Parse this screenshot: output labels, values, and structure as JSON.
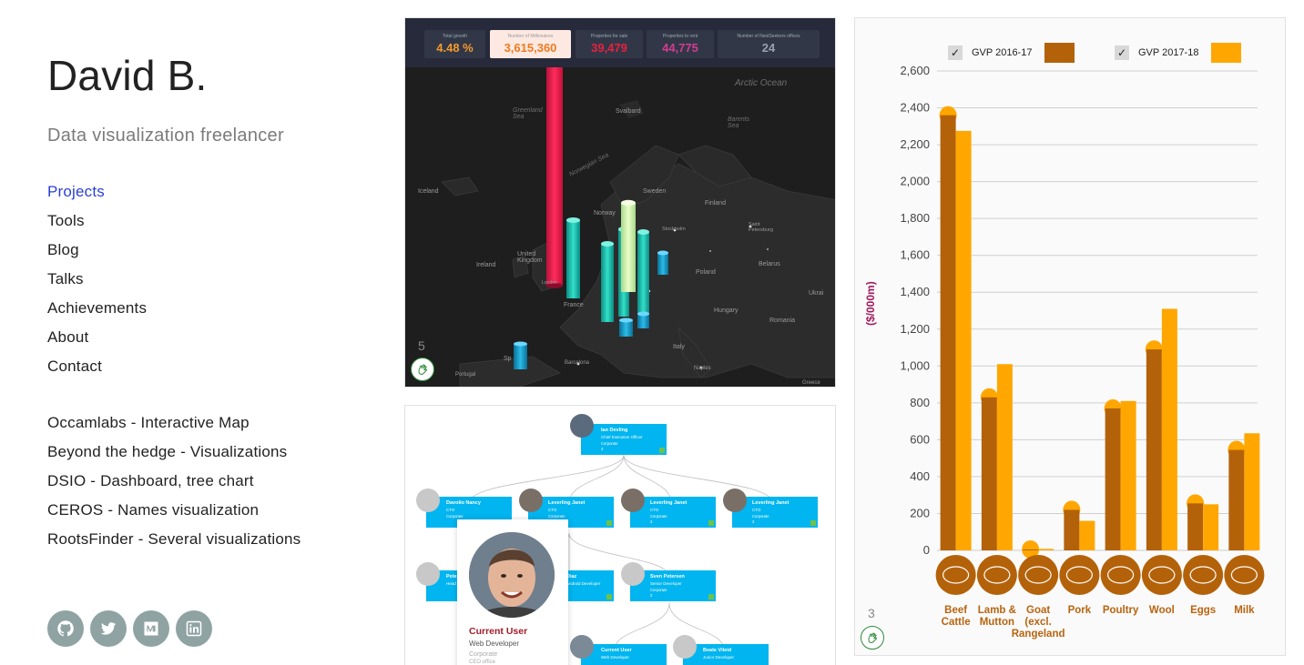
{
  "site": {
    "title": "David B.",
    "subtitle": "Data visualization freelancer"
  },
  "nav": [
    {
      "label": "Projects",
      "active": true
    },
    {
      "label": "Tools"
    },
    {
      "label": "Blog"
    },
    {
      "label": "Talks"
    },
    {
      "label": "Achievements"
    },
    {
      "label": "About"
    },
    {
      "label": "Contact"
    }
  ],
  "projects": [
    {
      "label": "Occamlabs - Interactive Map"
    },
    {
      "label": "Beyond the hedge - Visualizations"
    },
    {
      "label": "DSIO - Dashboard, tree chart"
    },
    {
      "label": "CEROS - Names visualization"
    },
    {
      "label": "RootsFinder - Several visualizations"
    }
  ],
  "socials": [
    {
      "name": "github-icon"
    },
    {
      "name": "twitter-icon"
    },
    {
      "name": "medium-icon"
    },
    {
      "name": "linkedin-icon"
    }
  ],
  "map_card": {
    "number": "5",
    "kpis": [
      {
        "label": "Total growth",
        "value": "4.48 %",
        "color": "#f39a2b"
      },
      {
        "label": "Number of Millionaires",
        "value": "3,615,360",
        "color": "#f07a1f"
      },
      {
        "label": "Properties for sale",
        "value": "39,479",
        "color": "#e8213f"
      },
      {
        "label": "Properties to rent",
        "value": "44,775",
        "color": "#d13d8f"
      },
      {
        "label": "Number of NestSeekers offices",
        "value": "24",
        "color": "#9a9fae"
      }
    ],
    "labels": {
      "arctic": "Arctic Ocean",
      "greenland_sea": "Greenland Sea",
      "barents_sea": "Barents Sea",
      "norwegian_sea": "Norwegian Sea",
      "svalbard": "Svalbard",
      "iceland": "Iceland",
      "sweden": "Sweden",
      "finland": "Finland",
      "norway": "Norway",
      "stockholm": "Stockholm",
      "st_petersburg": "Saint Petersburg",
      "uk": "United Kingdom",
      "ireland": "Ireland",
      "poland": "Poland",
      "belarus": "Belarus",
      "ukraine": "Ukrai",
      "france": "France",
      "hungary": "Hungary",
      "romania": "Romania",
      "italy": "Italy",
      "spain": "Sp",
      "barcelona": "Barcelona",
      "naples": "Naples",
      "portugal": "Portugal",
      "london": "London",
      "greece": "Greece"
    }
  },
  "org_card": {
    "root": {
      "name": "Ian Devling",
      "role": "Chief Executive Officer",
      "group": "Corporate",
      "count": "4"
    },
    "level1": [
      {
        "name": "Davolio Nancy",
        "role": "CTO",
        "group": "Corporate",
        "count": "3"
      },
      {
        "name": "Leverling Janet",
        "role": "CTO",
        "group": "Corporate",
        "count": "3"
      },
      {
        "name": "Leverling Janet",
        "role": "CTO",
        "group": "Corporate",
        "count": "3"
      },
      {
        "name": "Leverling Janet",
        "role": "CTO",
        "group": "Corporate",
        "count": "3"
      }
    ],
    "level2": [
      {
        "name": "Pete",
        "role": "Head",
        "group": "Corp",
        "count": "3"
      },
      {
        "name": "Diaz",
        "role": "Android Developer",
        "group": "",
        "count": ""
      },
      {
        "name": "Sven Petersen",
        "role": "Senior Developer",
        "group": "Corporate",
        "count": "2"
      }
    ],
    "level3": [
      {
        "name": "Current User",
        "role": "Web Developer",
        "group": "",
        "count": ""
      },
      {
        "name": "Beate Vileid",
        "role": "Junior Developer",
        "group": "",
        "count": ""
      }
    ],
    "popup": {
      "name": "Current User",
      "role": "Web Developer",
      "group": "Corporate",
      "office": "CEO office"
    }
  },
  "chart_card": {
    "number": "3"
  },
  "chart_data": {
    "type": "bar",
    "title": "",
    "xlabel": "",
    "ylabel": "($/000m)",
    "ylim": [
      0,
      2600
    ],
    "yticks": [
      "0",
      "200",
      "400",
      "600",
      "800",
      "1,000",
      "1,200",
      "1,400",
      "1,600",
      "1,800",
      "2,000",
      "2,200",
      "2,400",
      "2,600"
    ],
    "categories": [
      "Beef Cattle",
      "Lamb & Mutton",
      "Goat (excl. Rangeland",
      "Pork",
      "Poultry",
      "Wool",
      "Eggs",
      "Milk"
    ],
    "category_lines": [
      [
        "Beef",
        "Cattle"
      ],
      [
        "Lamb &",
        "Mutton"
      ],
      [
        "Goat",
        "(excl.",
        "Rangeland"
      ],
      [
        "Pork"
      ],
      [
        "Poultry"
      ],
      [
        "Wool"
      ],
      [
        "Eggs"
      ],
      [
        "Milk"
      ]
    ],
    "series": [
      {
        "name": "GVP 2016-17",
        "color": "#b4620a",
        "values": [
          2360,
          830,
          5,
          220,
          770,
          1090,
          255,
          545
        ]
      },
      {
        "name": "GVP 2017-18",
        "color": "#ffa700",
        "values": [
          2275,
          1010,
          8,
          160,
          810,
          1310,
          250,
          635
        ]
      }
    ],
    "grid": true,
    "legend": "top"
  }
}
